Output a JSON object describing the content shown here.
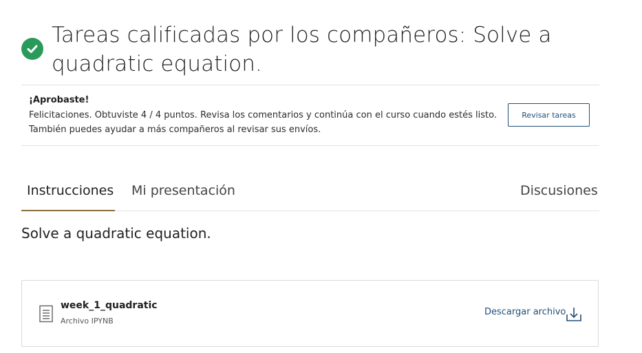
{
  "header": {
    "title": "Tareas calificadas por los compañeros: Solve a quadratic equation.",
    "status_icon": "check-circle-icon"
  },
  "result": {
    "heading": "¡Aprobaste!",
    "line1": "Felicitaciones. Obtuviste 4 / 4 puntos. Revisa los comentarios y continúa con el curso cuando estés listo.",
    "line2": "También puedes ayudar a más compañeros al revisar sus envíos.",
    "review_button": "Revisar tareas"
  },
  "tabs": [
    {
      "label": "Instrucciones",
      "active": true
    },
    {
      "label": "Mi presentación",
      "active": false
    },
    {
      "label": "Discusiones",
      "active": false
    }
  ],
  "instructions": {
    "text": "Solve a quadratic equation."
  },
  "attachment": {
    "name": "week_1_quadratic",
    "type": "Archivo IPYNB",
    "download_label": "Descargar archivo",
    "icon": "file-icon",
    "download_icon": "download-icon"
  },
  "colors": {
    "success": "#2a9a5b",
    "link": "#1f4e79",
    "tab_underline": "#8a6d3b"
  }
}
